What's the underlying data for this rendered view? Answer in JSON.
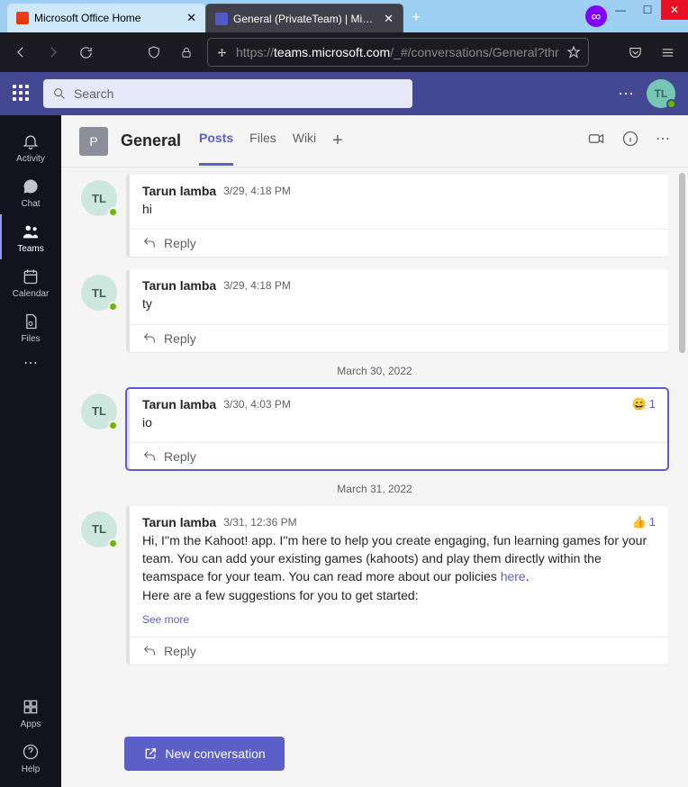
{
  "window": {
    "minimize": "—",
    "maximize": "☐",
    "close": "✕"
  },
  "browser": {
    "tabs": [
      {
        "label": "Microsoft Office Home",
        "close": "✕"
      },
      {
        "label": "General (PrivateTeam) | Micros",
        "close": "✕"
      }
    ],
    "url_prefix": "https://",
    "url_host": "teams.microsoft.com",
    "url_path": "/_#/conversations/General?thr",
    "ext_badge": "∞"
  },
  "header": {
    "search_placeholder": "Search",
    "me_initials": "TL"
  },
  "rail": [
    {
      "key": "activity",
      "label": "Activity"
    },
    {
      "key": "chat",
      "label": "Chat"
    },
    {
      "key": "teams",
      "label": "Teams"
    },
    {
      "key": "calendar",
      "label": "Calendar"
    },
    {
      "key": "files",
      "label": "Files"
    }
  ],
  "rail_foot": [
    {
      "key": "apps",
      "label": "Apps"
    },
    {
      "key": "help",
      "label": "Help"
    }
  ],
  "channel": {
    "team_initial": "P",
    "name": "General",
    "tabs": [
      {
        "label": "Posts"
      },
      {
        "label": "Files"
      },
      {
        "label": "Wiki"
      }
    ]
  },
  "dates": {
    "d30": "March 30, 2022",
    "d31": "March 31, 2022"
  },
  "posts": [
    {
      "author": "Tarun lamba",
      "initials": "TL",
      "ts": "3/29, 4:18 PM",
      "text": "hi",
      "reply": "Reply"
    },
    {
      "author": "Tarun lamba",
      "initials": "TL",
      "ts": "3/29, 4:18 PM",
      "text": "ty",
      "reply": "Reply"
    },
    {
      "author": "Tarun lamba",
      "initials": "TL",
      "ts": "3/30, 4:03 PM",
      "text": "io",
      "reply": "Reply",
      "reaction_emoji": "😄",
      "reaction_count": "1"
    },
    {
      "author": "Tarun lamba",
      "initials": "TL",
      "ts": "3/31, 12:36 PM",
      "text_pre": "Hi, I''m the Kahoot! app. I''m here to help you create engaging, fun learning games for your team. You can add your existing games (kahoots) and play them directly within the teamspace for your team. You can read more about our policies ",
      "link": "here",
      "text_post": ".",
      "seemore": "See more",
      "reply": "Reply",
      "reaction_emoji": "👍",
      "reaction_count": "1"
    }
  ],
  "compose": {
    "label": "New conversation"
  }
}
